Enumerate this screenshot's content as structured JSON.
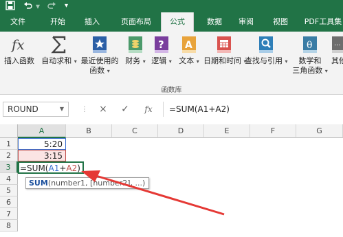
{
  "quick_access": {
    "save_icon": "save-icon",
    "undo_icon": "undo-icon",
    "redo_icon": "redo-icon",
    "customize_icon": "customize-icon"
  },
  "tabs": [
    "文件",
    "开始",
    "插入",
    "页面布局",
    "公式",
    "数据",
    "审阅",
    "视图",
    "PDF工具集"
  ],
  "active_tab": "公式",
  "ribbon": {
    "insert_function": "插入函数",
    "autosum": "自动求和",
    "recent_line1": "最近使用的",
    "recent_line2": "函数",
    "financial": "财务",
    "logical": "逻辑",
    "text": "文本",
    "datetime": "日期和时间",
    "lookup": "查找与引用",
    "math_line1": "数学和",
    "math_line2": "三角函数",
    "other": "其他",
    "group_label": "函数库"
  },
  "formula_bar": {
    "name_box": "ROUND",
    "cancel_icon": "×",
    "enter_icon": "✓",
    "fx_icon": "fx",
    "formula": "=SUM(A1+A2)"
  },
  "grid": {
    "columns": [
      "A",
      "B",
      "C",
      "D",
      "E",
      "F",
      "G"
    ],
    "rows": [
      "1",
      "2",
      "3",
      "4",
      "5",
      "6",
      "7",
      "8"
    ],
    "cells": {
      "A1": "5:20",
      "A2": "3:15",
      "A3_prefix": "=SUM(",
      "A3_ref1": "A1",
      "A3_plus": "+",
      "A3_ref2": "A2",
      "A3_suffix": ")"
    },
    "tooltip": {
      "fn": "SUM",
      "args": "(number1, [number2], ...)"
    }
  },
  "colors": {
    "accent": "#217346",
    "ref_blue": "#3a6fd0",
    "ref_red": "#c0504d",
    "arrow": "#e53935"
  }
}
